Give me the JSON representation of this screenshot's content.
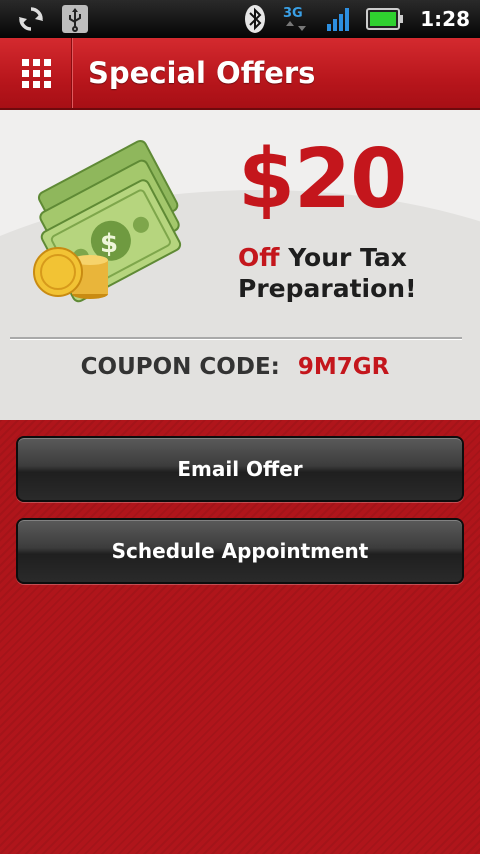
{
  "status_bar": {
    "time": "1:28",
    "network_type": "3G",
    "icons": [
      "sync-icon",
      "usb-icon",
      "bluetooth-icon",
      "network-3g-icon",
      "signal-icon",
      "battery-icon"
    ],
    "battery_color": "#2fd02f"
  },
  "header": {
    "title": "Special Offers",
    "menu_icon": "grid-menu-icon"
  },
  "offer": {
    "amount": "$20",
    "off_word": "Off",
    "rest_line1": " Your Tax",
    "line2": "Preparation!",
    "coupon_label": "COUPON CODE:",
    "coupon_code": "9M7GR",
    "art": "money-stack-icon"
  },
  "actions": {
    "email_label": "Email Offer",
    "schedule_label": "Schedule Appointment"
  },
  "colors": {
    "brand_red": "#c4161c",
    "background_red": "#b0151b",
    "panel_bg": "#f0efee"
  }
}
